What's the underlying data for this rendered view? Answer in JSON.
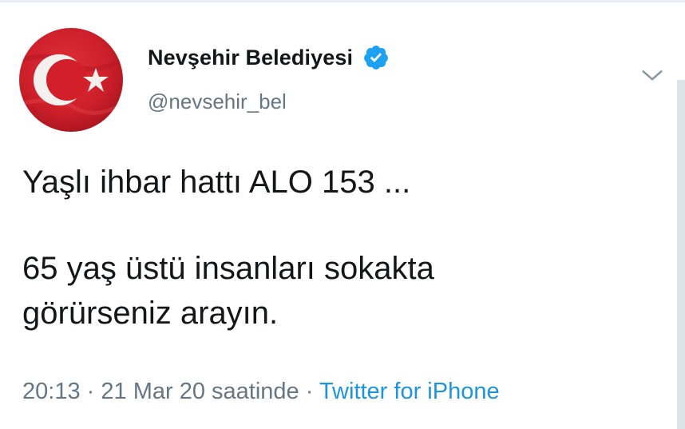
{
  "tweet": {
    "author": {
      "display_name": "Nevşehir Belediyesi",
      "handle": "@nevsehir_bel",
      "verified": true,
      "avatar_icon": "turkish-flag-avatar"
    },
    "text_lines": [
      "Yaşlı ihbar hattı ALO 153 ...",
      "65 yaş üstü insanları sokakta",
      "görürseniz arayın."
    ],
    "meta": {
      "time": "20:13",
      "separator": "·",
      "date": "21 Mar 20 saatinde",
      "source": "Twitter for iPhone"
    }
  },
  "colors": {
    "text_primary": "#14171a",
    "text_secondary": "#657786",
    "link": "#1b95e0",
    "verified_badge": "#1da1f2",
    "flag_red": "#d21f2a"
  },
  "icons": {
    "verified": "verified-badge-icon",
    "menu": "chevron-down-icon"
  }
}
